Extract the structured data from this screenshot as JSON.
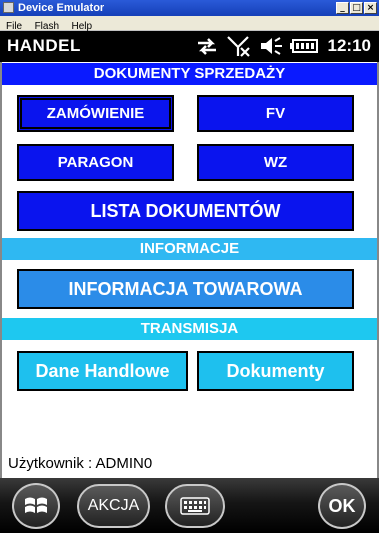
{
  "window": {
    "title": "Device Emulator",
    "buttons": [
      "_",
      "□",
      "×"
    ]
  },
  "menu": [
    "File",
    "Flash",
    "Help"
  ],
  "statusbar": {
    "app_name": "HANDEL",
    "time": "12:10",
    "icons": [
      "sync-arrows-icon",
      "no-signal-icon",
      "speaker-icon",
      "battery-icon"
    ]
  },
  "sections": {
    "sales": "DOKUMENTY SPRZEDAŻY",
    "info": "INFORMACJE",
    "transmission": "TRANSMISJA"
  },
  "buttons": {
    "zamowienie": "ZAMÓWIENIE",
    "fv": "FV",
    "paragon": "PARAGON",
    "wz": "WZ",
    "lista": "LISTA DOKUMENTÓW",
    "informacja_towarowa": "INFORMACJA TOWAROWA",
    "dane_handlowe": "Dane Handlowe",
    "dokumenty": "Dokumenty"
  },
  "user_text": "Użytkownik : ADMIN0",
  "softkeys": {
    "left": "AKCJA",
    "right": "OK"
  },
  "colors": {
    "dark_button": "#0a14ee",
    "section_blue": "#0a1aff",
    "info_button": "#2b8ce8",
    "transmission": "#1ec0ee"
  }
}
